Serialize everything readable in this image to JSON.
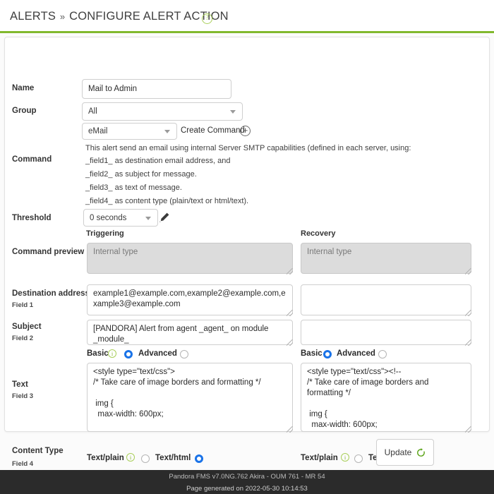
{
  "header": {
    "breadcrumb_main": "ALERTS",
    "breadcrumb_sep": "»",
    "breadcrumb_page": "CONFIGURE ALERT ACTION",
    "help_icon": "question-mark-icon",
    "accent_color": "#82b92e"
  },
  "form": {
    "name": {
      "label": "Name",
      "value": "Mail to Admin"
    },
    "group": {
      "label": "Group",
      "value": "All"
    },
    "command": {
      "label": "Command",
      "value": "eMail",
      "create_link": "Create Command",
      "plus_icon": "plus-circle-icon",
      "description": [
        "This alert send an email using internal Server SMTP capabilities (defined in each server, using:",
        "_field1_ as destination email address, and",
        "_field2_ as subject for message.",
        "_field3_ as text of message.",
        "_field4_ as content type (plain/text or html/text)."
      ]
    },
    "threshold": {
      "label": "Threshold",
      "value": "0 seconds",
      "edit_icon": "pencil-icon"
    },
    "columns": {
      "triggering": "Triggering",
      "recovery": "Recovery"
    },
    "command_preview": {
      "label": "Command preview",
      "triggering_value": "Internal type",
      "recovery_value": "Internal type"
    },
    "field1": {
      "label": "Destination address",
      "sublabel": "Field 1",
      "triggering_value": "example1@example.com,example2@example.com,example3@example.com",
      "recovery_value": ""
    },
    "field2": {
      "label": "Subject",
      "sublabel": "Field 2",
      "triggering_value": "[PANDORA] Alert from agent _agent_ on module _module_",
      "recovery_value": ""
    },
    "field3": {
      "label": "Text",
      "sublabel": "Field 3",
      "mode_basic": "Basic",
      "mode_advanced": "Advanced",
      "triggering_selected_mode": "Basic",
      "recovery_selected_mode": "Basic",
      "triggering_value": "<style type=\"text/css\">\n/* Take care of image borders and formatting */\n\n img {\n  max-width: 600px;",
      "recovery_value": "<style type=\"text/css\"><!--\n/* Take care of image borders and formatting */\n\n img {\n  max-width: 600px;"
    },
    "field4": {
      "label": "Content Type",
      "sublabel": "Field 4",
      "option_plain": "Text/plain",
      "option_html": "Text/html",
      "triggering_selected": "Text/html",
      "recovery_selected": "Text/html"
    }
  },
  "actions": {
    "update_label": "Update",
    "update_icon": "refresh-icon"
  },
  "footer": {
    "line1": "Pandora FMS v7.0NG.762 Akira - OUM 761 - MR 54",
    "line2": "Page generated on 2022-05-30 10:14:53"
  }
}
